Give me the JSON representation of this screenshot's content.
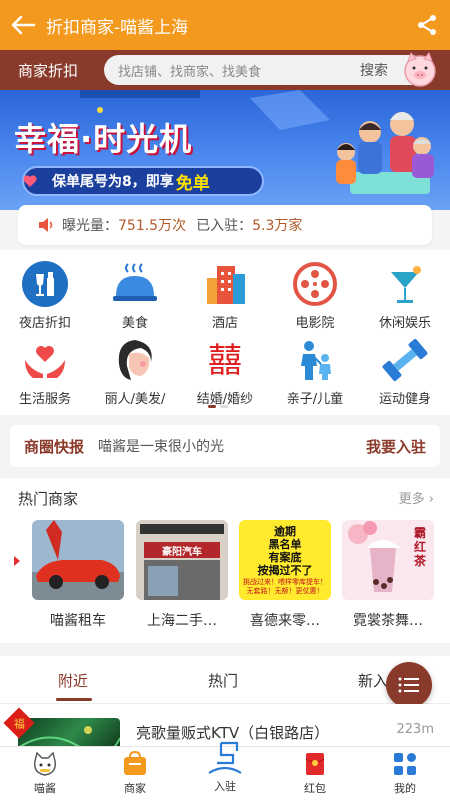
{
  "header": {
    "title": "折扣商家-喵酱上海",
    "back_icon": "back-arrow-icon",
    "share_icon": "share-icon"
  },
  "search": {
    "label": "商家折扣",
    "placeholder": "找店铺、找商家、找美食",
    "button": "搜索"
  },
  "banner": {
    "title": "幸福·时光机",
    "subtitle": "保单尾号为8，即享",
    "highlight": "免单"
  },
  "stats": {
    "exposure_label": "曝光量：",
    "exposure_value": "751.5万次",
    "joined_label": "已入驻：",
    "joined_value": "5.3万家"
  },
  "categories": [
    {
      "label": "夜店折扣",
      "icon": "nightclub-icon",
      "color": "#1f6fc2"
    },
    {
      "label": "美食",
      "icon": "food-cloche-icon",
      "color": "#2a7bd6"
    },
    {
      "label": "酒店",
      "icon": "hotel-building-icon",
      "color": "#e7533b"
    },
    {
      "label": "电影院",
      "icon": "film-reel-icon",
      "color": "#e25545"
    },
    {
      "label": "休闲娱乐",
      "icon": "cocktail-icon",
      "color": "#2aa3c9"
    },
    {
      "label": "生活服务",
      "icon": "hands-heart-icon",
      "color": "#ef4a4a"
    },
    {
      "label": "丽人/美发/",
      "icon": "beauty-face-icon",
      "color": "#333333"
    },
    {
      "label": "结婚/婚纱",
      "icon": "double-happiness-icon",
      "color": "#e02020"
    },
    {
      "label": "亲子/儿童",
      "icon": "parent-child-icon",
      "color": "#2a8ad6"
    },
    {
      "label": "运动健身",
      "icon": "dumbbell-icon",
      "color": "#2a7bd6"
    }
  ],
  "news": {
    "tag": "商圈快报",
    "text": "喵酱是一束很小的光",
    "button": "我要入驻"
  },
  "hot": {
    "title": "热门商家",
    "more": "更多 ›",
    "items": [
      {
        "label": "喵酱租车"
      },
      {
        "label": "上海二手…",
        "sign": "豪阳汽车"
      },
      {
        "label": "喜德来零…",
        "sign_lines": [
          "逾期",
          "黑名单",
          "有案底",
          "按揭过不了"
        ],
        "sign_bottom": "挑战过来！喂样零库提车！无套路！无额！更仗惠！"
      },
      {
        "label": "霓裳茶舞…",
        "sign": "霸红茶"
      }
    ]
  },
  "tabs": {
    "items": [
      "附近",
      "热门",
      "新入"
    ],
    "active": 0
  },
  "list": {
    "badge": "福",
    "name": "亮歌量贩式KTV（白银路店）",
    "distance": "223m"
  },
  "bottom_nav": [
    {
      "label": "喵酱",
      "icon": "cat-face-icon"
    },
    {
      "label": "商家",
      "icon": "shop-bag-icon"
    },
    {
      "label": "入驻",
      "icon": "join-icon"
    },
    {
      "label": "红包",
      "icon": "red-envelope-icon"
    },
    {
      "label": "我的",
      "icon": "profile-grid-icon"
    }
  ]
}
